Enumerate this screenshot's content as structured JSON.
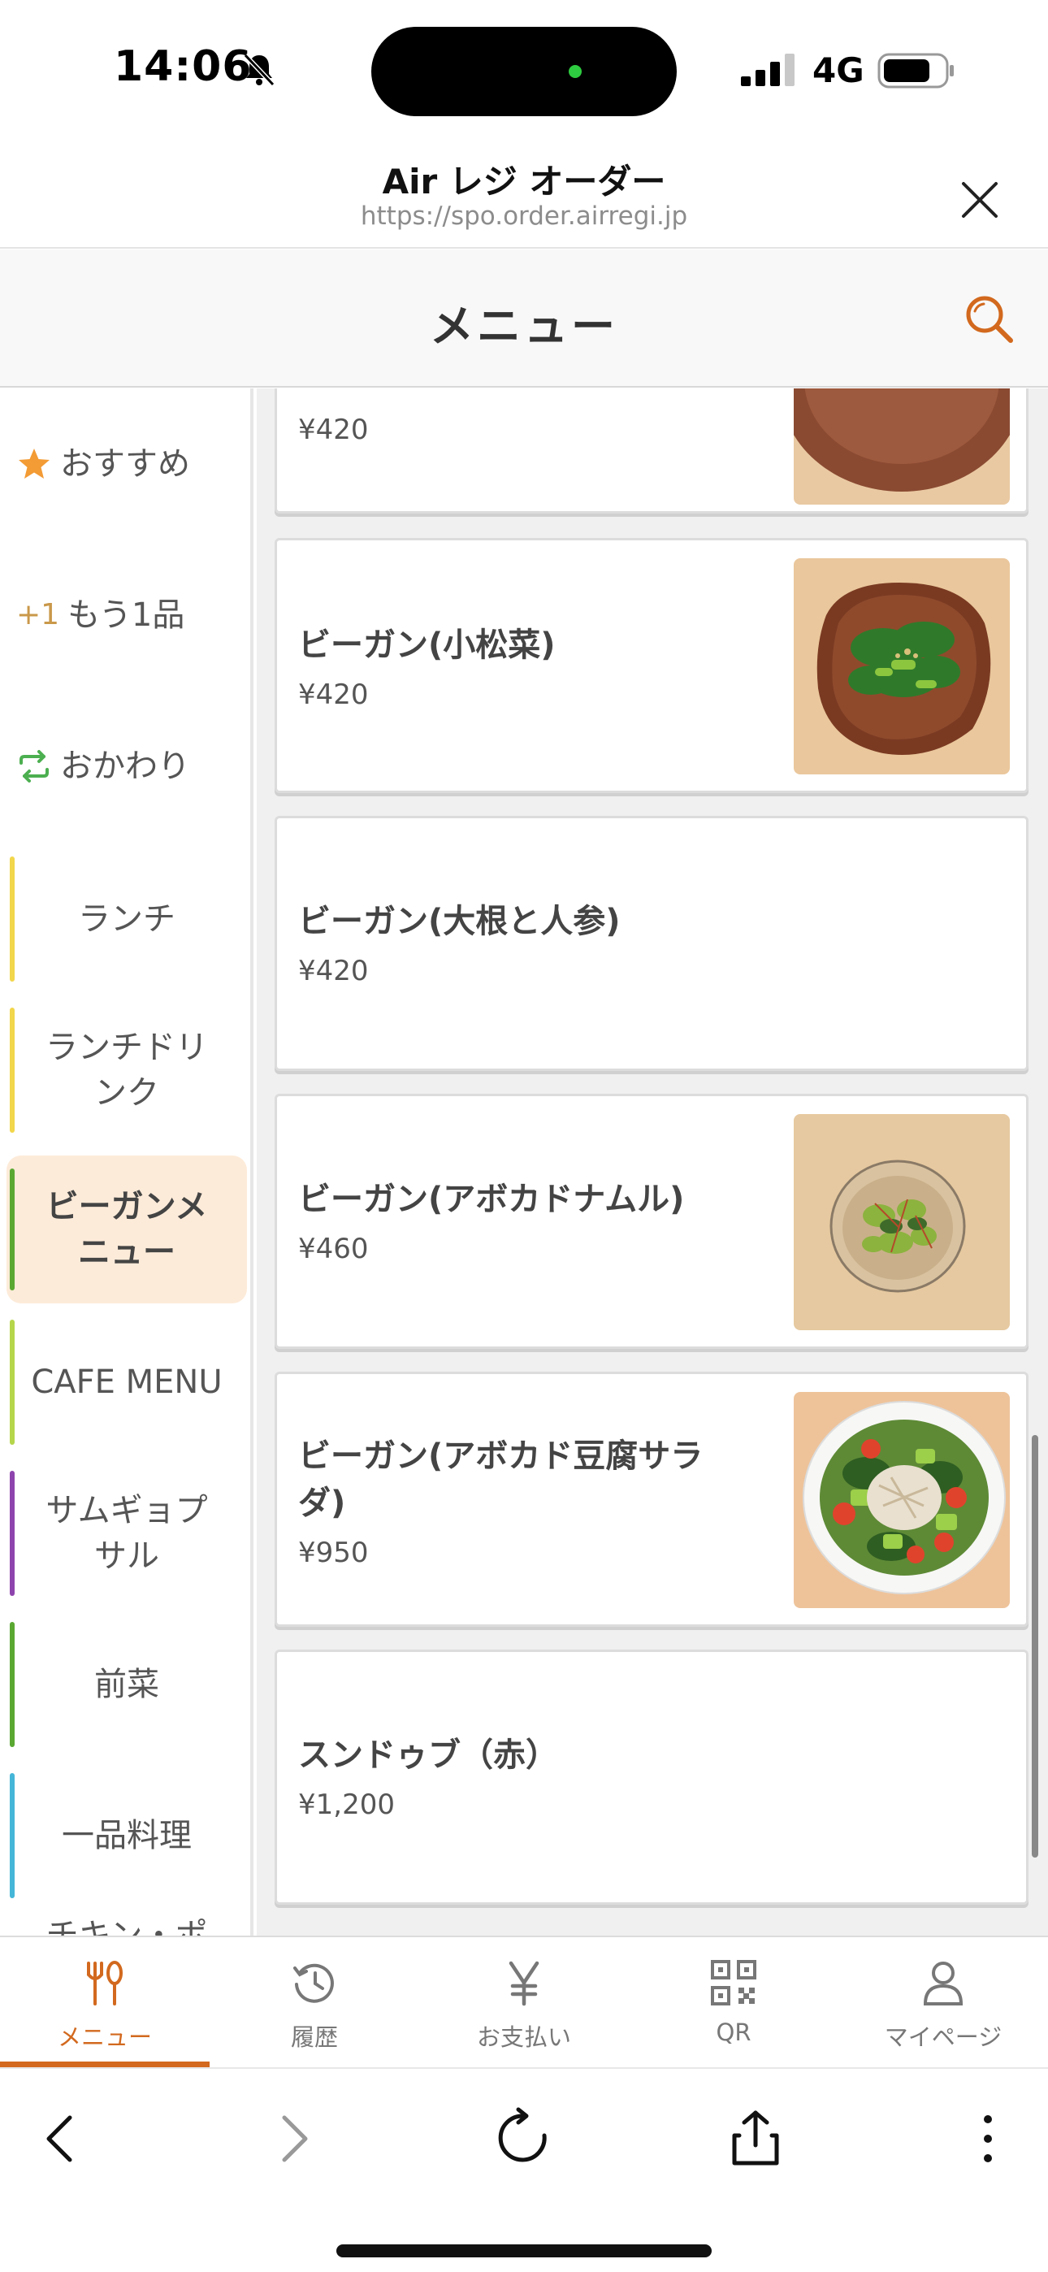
{
  "status": {
    "time": "14:06",
    "network": "4G"
  },
  "browser": {
    "title": "Air レジ オーダー",
    "url": "https://spo.order.airregi.jp"
  },
  "page": {
    "title": "メニュー"
  },
  "categories": [
    {
      "label": "おすすめ",
      "icon": "star-icon"
    },
    {
      "label": "もう1品",
      "icon": "plus-one-icon",
      "icon_text": "+1"
    },
    {
      "label": "おかわり",
      "icon": "refresh-icon"
    },
    {
      "label": "ランチ",
      "color": "#f2d64b"
    },
    {
      "label": "ランチドリンク",
      "color": "#f2d64b"
    },
    {
      "label": "ビーガンメニュー",
      "color": "#5aa832",
      "active": true
    },
    {
      "label": "CAFE MENU",
      "color": "#b5d64b"
    },
    {
      "label": "サムギョプサル",
      "color": "#8e44ad"
    },
    {
      "label": "前菜",
      "color": "#5aa832"
    },
    {
      "label": "一品料理",
      "color": "#45b6d8"
    },
    {
      "label": "チキン・ポ"
    }
  ],
  "items": [
    {
      "name": "",
      "price": "¥420",
      "has_image": true
    },
    {
      "name": "ビーガン(小松菜)",
      "price": "¥420",
      "has_image": true
    },
    {
      "name": "ビーガン(大根と人参)",
      "price": "¥420",
      "has_image": false
    },
    {
      "name": "ビーガン(アボカドナムル)",
      "price": "¥460",
      "has_image": true
    },
    {
      "name_line1": "ビーガン(アボカド豆腐サラ",
      "name_line2": "ダ)",
      "price": "¥950",
      "has_image": true
    },
    {
      "name": "スンドゥブ（赤）",
      "price": "¥1,200",
      "has_image": false
    }
  ],
  "tabs": [
    {
      "label": "メニュー",
      "icon": "fork-knife-icon",
      "active": true
    },
    {
      "label": "履歴",
      "icon": "history-icon"
    },
    {
      "label": "お支払い",
      "icon": "yen-icon"
    },
    {
      "label": "QR",
      "icon": "qr-icon"
    },
    {
      "label": "マイページ",
      "icon": "person-icon"
    }
  ],
  "colors": {
    "accent": "#d2691e",
    "active_category_bg": "#fdebd9"
  }
}
